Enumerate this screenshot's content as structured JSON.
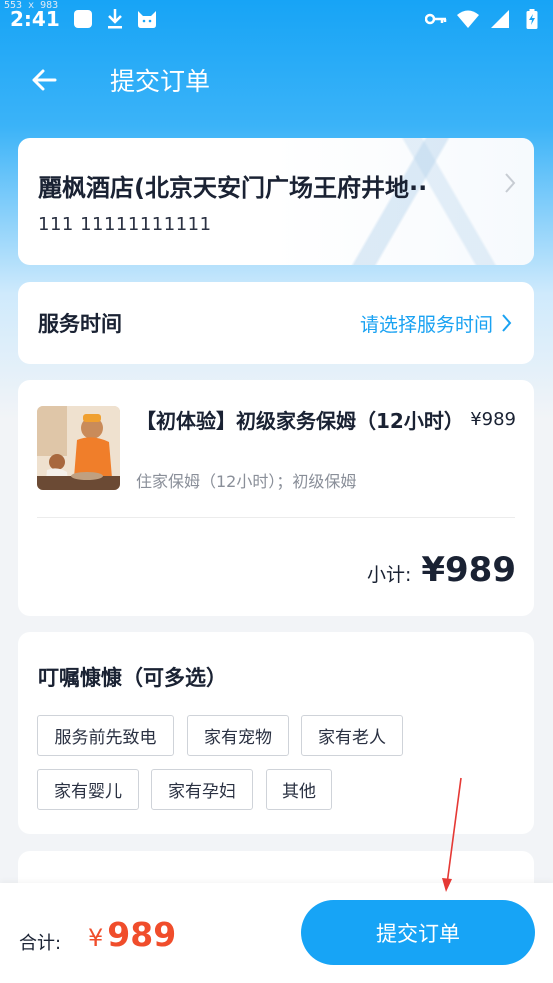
{
  "screenshot_label": "553 x 983",
  "status_bar": {
    "time": "2:41",
    "left_icons": [
      "square-icon",
      "download-icon",
      "cat-icon"
    ],
    "right_icons": [
      "key-icon",
      "wifi-icon",
      "signal-icon",
      "battery-icon"
    ]
  },
  "header": {
    "title": "提交订单",
    "back_icon": "back-arrow-icon"
  },
  "address": {
    "name": "麗枫酒店(北京天安门广场王府井地铁站店)",
    "name_display": "麗枫酒店(北京天安门广场王府井地··",
    "phone": "111 11111111111"
  },
  "service_time": {
    "label": "服务时间",
    "placeholder": "请选择服务时间"
  },
  "product": {
    "title": "【初体验】初级家务保姆（12小时）",
    "price": "¥989",
    "subtitle": "住家保姆（12小时）；初级保姆",
    "subtotal_label": "小计:",
    "subtotal_value": "¥989"
  },
  "notes": {
    "title": "叮嘱慷慷（可多选）",
    "tags": [
      "服务前先致电",
      "家有宠物",
      "家有老人",
      "家有婴儿",
      "家有孕妇",
      "其他"
    ]
  },
  "footer": {
    "total_label": "合计:",
    "currency": "¥",
    "total_value": "989",
    "submit_label": "提交订单"
  },
  "colors": {
    "accent": "#17a4f6",
    "price_red": "#f04d2b",
    "annotation_arrow": "#e53935"
  }
}
